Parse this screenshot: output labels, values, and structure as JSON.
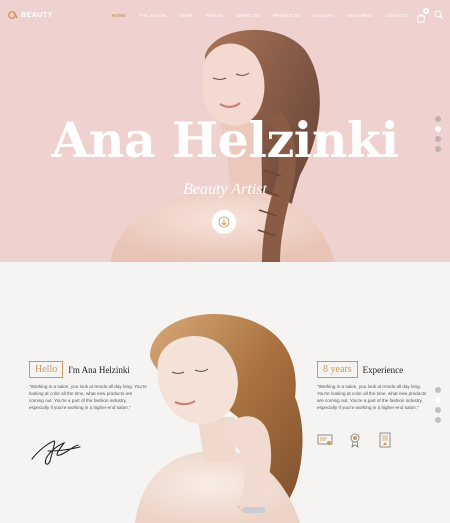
{
  "brand": {
    "name": "BEAUTY"
  },
  "nav": {
    "items": [
      {
        "label": "HOME",
        "active": true
      },
      {
        "label": "THE SALON",
        "active": false
      },
      {
        "label": "TEAM",
        "active": false
      },
      {
        "label": "PRICES",
        "active": false
      },
      {
        "label": "SERVICES",
        "active": false
      },
      {
        "label": "PRODUCTS",
        "active": false
      },
      {
        "label": "GALLERY",
        "active": false
      },
      {
        "label": "FEATURES",
        "active": false
      },
      {
        "label": "CONTACT",
        "active": false
      }
    ],
    "cart_count": "0",
    "icons": [
      "cart-icon",
      "search-icon"
    ]
  },
  "hero": {
    "title": "Ana Helzinki",
    "subtitle": "Beauty Artist",
    "scroll_icon": "arrow-down-icon"
  },
  "about": {
    "left": {
      "boxed": "Hello",
      "heading": "I'm Ana Helzinki",
      "text": "\"Working in a salon, you look at trends all day long. You're looking at color all the time, what new products are coming out. You're a part of the fashion industry, especially if you're working in a higher-end salon.\""
    },
    "right": {
      "boxed": "8 years",
      "heading": "Experience",
      "text": "\"Working in a salon, you look at trends all day long. You're looking at color all the time, what new products are coming out. You're a part of the fashion industry, especially if you're working in a higher-end salon.\"",
      "badges": [
        "certificate-icon",
        "award-medal-icon",
        "diploma-icon"
      ]
    }
  },
  "colors": {
    "accent": "#c79a5a",
    "hero_bg": "#efd2d0",
    "section_bg": "#f5f4f3"
  }
}
